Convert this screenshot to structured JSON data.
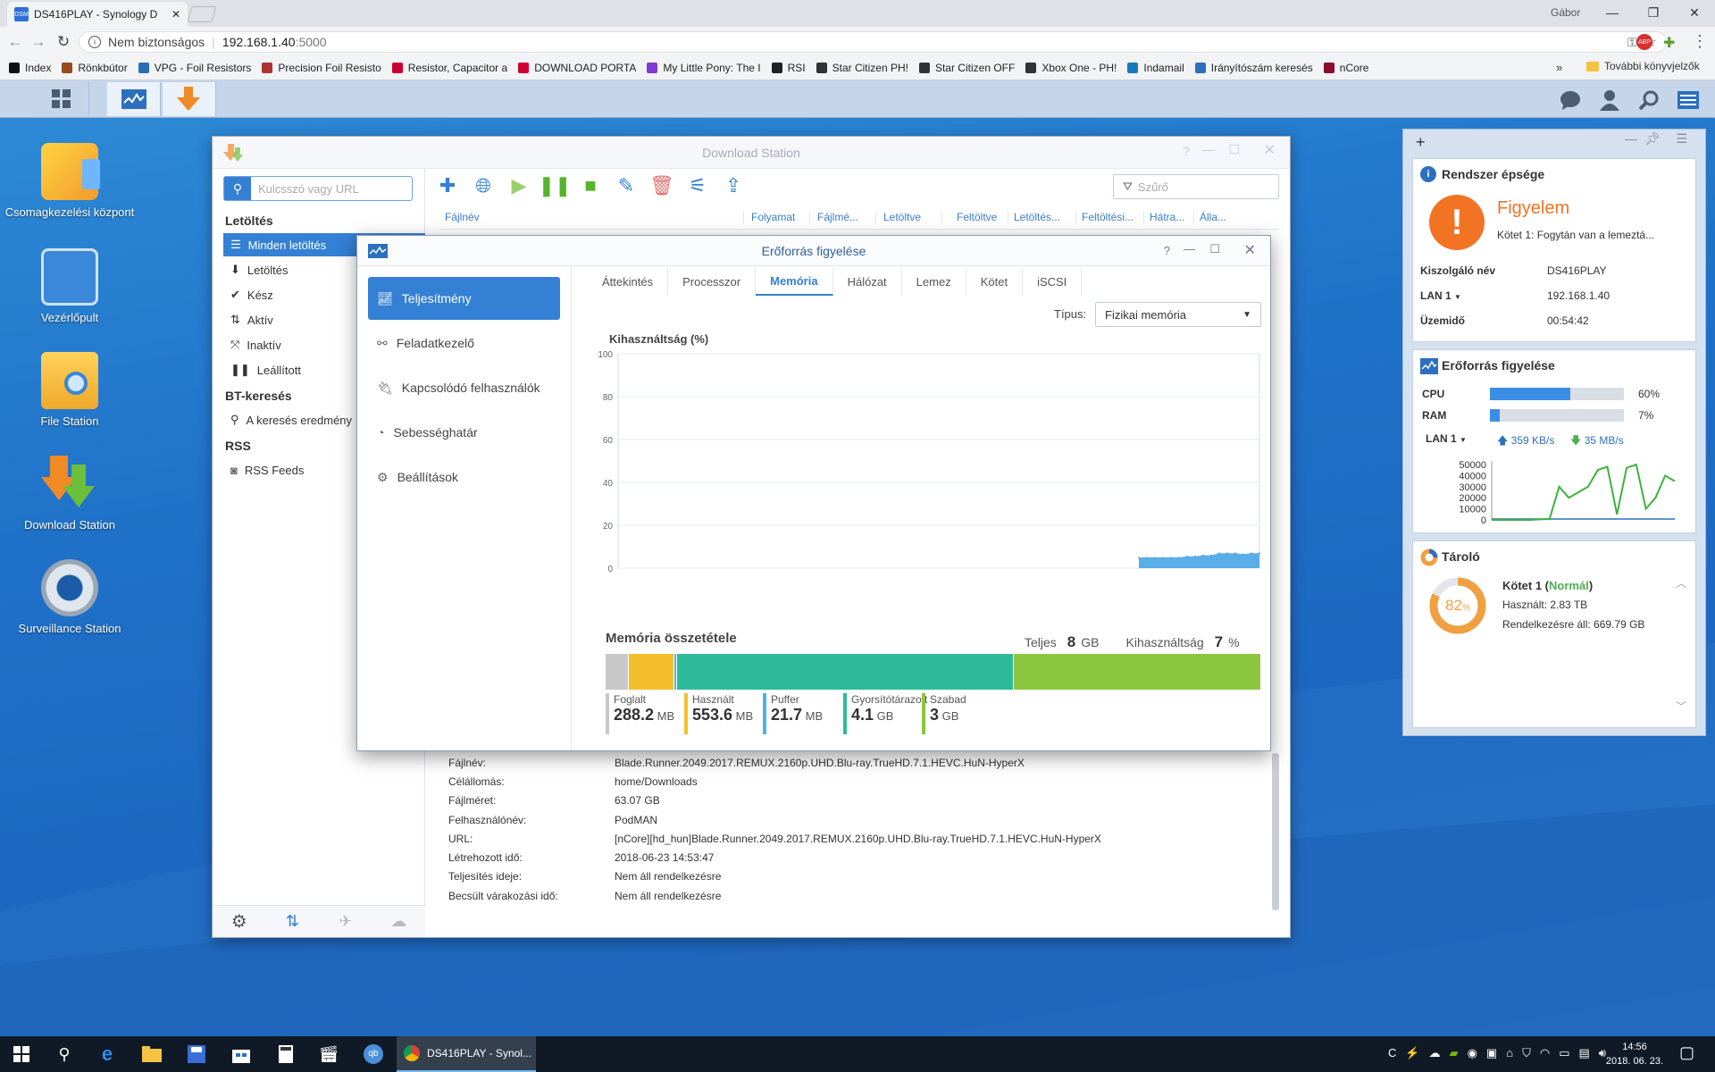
{
  "browser": {
    "tab_title": "DS416PLAY - Synology D",
    "tab_favicon": "DSM",
    "user": "Gábor",
    "security": "Nem biztonságos",
    "url_host": "192.168.1.40",
    "url_port": ":5000",
    "bookmarks": [
      "Index",
      "Rönkbútor",
      "VPG - Foil Resistors",
      "Precision Foil Resisto",
      "Resistor, Capacitor a",
      "DOWNLOAD PORTA",
      "My Little Pony: The I",
      "RSI",
      "Star Citizen PH!",
      "Star Citizen OFF",
      "Xbox One - PH!",
      "Indamail",
      "Irányítószám keresés",
      "nCore"
    ],
    "bookmarks_more": "»",
    "other_bookmarks": "További könyvjelzők"
  },
  "desktop": {
    "icons": [
      {
        "label": "Csomagkezelési központ"
      },
      {
        "label": "Vezérlőpult"
      },
      {
        "label": "File Station"
      },
      {
        "label": "Download Station"
      },
      {
        "label": "Surveillance Station"
      }
    ]
  },
  "download_station": {
    "title": "Download Station",
    "search_placeholder": "Kulcsszó vagy URL",
    "filter_placeholder": "Szűrő",
    "section_downloads": "Letöltés",
    "items": [
      "Minden letöltés",
      "Letöltés",
      "Kész",
      "Aktív",
      "Inaktív",
      "Leállított"
    ],
    "section_bt": "BT-keresés",
    "bt_item": "A keresés eredmény",
    "section_rss": "RSS",
    "rss_item": "RSS Feeds",
    "columns": [
      "Fájlnév",
      "Folyamat",
      "Fájlmé...",
      "Letöltve",
      "Feltöltve",
      "Letöltés...",
      "Feltöltési...",
      "Hátra...",
      "Álla..."
    ],
    "details": [
      {
        "k": "Fájlnév:",
        "v": "Blade.Runner.2049.2017.REMUX.2160p.UHD.Blu-ray.TrueHD.7.1.HEVC.HuN-HyperX"
      },
      {
        "k": "Célállomás:",
        "v": "home/Downloads"
      },
      {
        "k": "Fájlméret:",
        "v": "63.07 GB"
      },
      {
        "k": "Felhasználónév:",
        "v": "PodMAN"
      },
      {
        "k": "URL:",
        "v": "[nCore][hd_hun]Blade.Runner.2049.2017.REMUX.2160p.UHD.Blu-ray.TrueHD.7.1.HEVC.HuN-HyperX"
      },
      {
        "k": "Létrehozott idő:",
        "v": "2018-06-23 14:53:47"
      },
      {
        "k": "Teljesítés ideje:",
        "v": "Nem áll rendelkezésre"
      },
      {
        "k": "Becsült várakozási idő:",
        "v": "Nem áll rendelkezésre"
      }
    ]
  },
  "resource_monitor": {
    "title": "Erőforrás figyelése",
    "nav": [
      "Teljesítmény",
      "Feladatkezelő",
      "Kapcsolódó felhasználók",
      "Sebességhatár",
      "Beállítások"
    ],
    "tabs": [
      "Áttekintés",
      "Processzor",
      "Memória",
      "Hálózat",
      "Lemez",
      "Kötet",
      "iSCSI"
    ],
    "selected_tab": "Memória",
    "type_label": "Típus:",
    "type_value": "Fizikai memória",
    "chart_label": "Kihasználtság (%)",
    "composition_title": "Memória összetétele",
    "total_label": "Teljes",
    "total_value": "8",
    "total_unit": "GB",
    "usage_label": "Kihasználtság",
    "usage_value": "7",
    "usage_unit": "%",
    "segments": [
      {
        "name": "Foglalt",
        "value": "288.2",
        "unit": "MB",
        "color": "#c8c8c8",
        "frac": 0.036
      },
      {
        "name": "Használt",
        "value": "553.6",
        "unit": "MB",
        "color": "#f5bf2c",
        "frac": 0.069
      },
      {
        "name": "Puffer",
        "value": "21.7",
        "unit": "MB",
        "color": "#4cb3e8",
        "frac": 0.004
      },
      {
        "name": "Gyorsítótárazott",
        "value": "4.1",
        "unit": "GB",
        "color": "#2dbb9a",
        "frac": 0.513
      },
      {
        "name": "Szabad",
        "value": "3",
        "unit": "GB",
        "color": "#8cc63f",
        "frac": 0.378
      }
    ]
  },
  "chart_data": {
    "type": "area",
    "ylabel": "Kihasználtság (%)",
    "ylim": [
      0,
      100
    ],
    "yticks": [
      0,
      20,
      40,
      60,
      80,
      100
    ],
    "series": [
      {
        "values": [
          5,
          5,
          5,
          5,
          5,
          5,
          5.5,
          5.5,
          6,
          6,
          7,
          7,
          7,
          6.5,
          7,
          7
        ]
      }
    ],
    "color": "#5aaee8"
  },
  "widgets": {
    "health_title": "Rendszer épsége",
    "health_status": "Figyelem",
    "health_msg": "Kötet 1: Fogytán van a lemeztá...",
    "server_label": "Kiszolgáló név",
    "server_value": "DS416PLAY",
    "lan_label": "LAN 1",
    "lan_value": "192.168.1.40",
    "uptime_label": "Üzemidő",
    "uptime_value": "00:54:42",
    "rm_title": "Erőforrás figyelése",
    "cpu_label": "CPU",
    "cpu_value": "60%",
    "cpu_frac": 0.6,
    "ram_label": "RAM",
    "ram_value": "7%",
    "ram_frac": 0.07,
    "net_label": "LAN 1",
    "up_speed": "359 KB/s",
    "down_speed": "35 MB/s",
    "net_ticks": [
      "50000",
      "40000",
      "30000",
      "20000",
      "10000",
      "0"
    ],
    "net_values": [
      0,
      0,
      0,
      0,
      0,
      500,
      800,
      30000,
      20000,
      25000,
      30000,
      45000,
      48000,
      5000,
      47000,
      50000,
      10000,
      20000,
      40000,
      35000
    ],
    "storage_title": "Tároló",
    "storage_pct": "82",
    "storage_frac": 0.82,
    "vol_name": "Kötet 1",
    "vol_status": "Normál",
    "used_label": "Használt: 2.83 TB",
    "avail_label": "Rendelkezésre áll: 669.79 GB"
  },
  "taskbar": {
    "app_label": "DS416PLAY - Synol...",
    "time": "14:56",
    "date": "2018. 06. 23."
  }
}
